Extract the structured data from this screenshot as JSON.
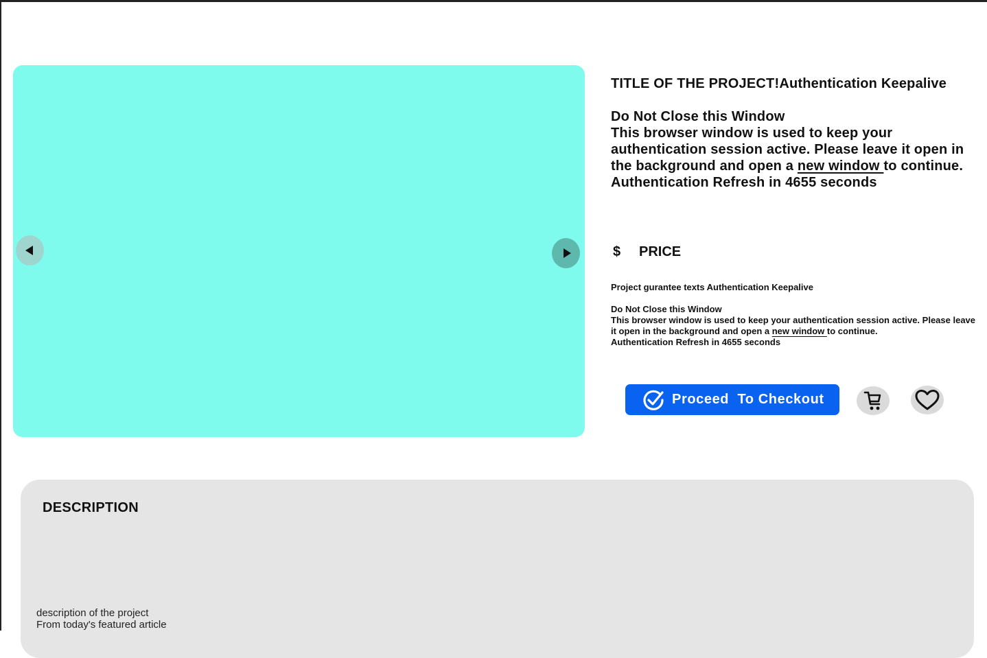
{
  "project": {
    "title": "TITLE OF THE PROJECT!Authentication Keepalive",
    "notice_heading": "Do Not Close this Window",
    "notice_text_before": "This browser window is used to keep your authentication session active. Please leave it open in the background and open a ",
    "notice_link": "new window ",
    "notice_text_after": "to continue.",
    "refresh_text": "Authentication Refresh in 4655 seconds"
  },
  "price": {
    "currency_symbol": "$",
    "label": "PRICE"
  },
  "guarantee": {
    "title": "Project gurantee texts Authentication Keepalive",
    "notice_heading": "Do Not Close this Window",
    "notice_text_before": "This browser window is used to keep your authentication session active. Please leave it open in the background and open a ",
    "notice_link": "new window ",
    "notice_text_after": "to continue.",
    "refresh_text": "Authentication Refresh in 4655 seconds"
  },
  "actions": {
    "checkout_label": "Proceed  To Checkout",
    "checkout_icon": "check-circle-icon",
    "cart_icon": "cart-icon",
    "favorite_icon": "heart-icon"
  },
  "description": {
    "heading": "DESCRIPTION",
    "line1": "description of the project",
    "line2": "From today's featured article"
  },
  "colors": {
    "carousel_bg": "#7ffbee",
    "checkout_bg": "#0a62f0",
    "panel_bg": "#e5e5e5"
  }
}
